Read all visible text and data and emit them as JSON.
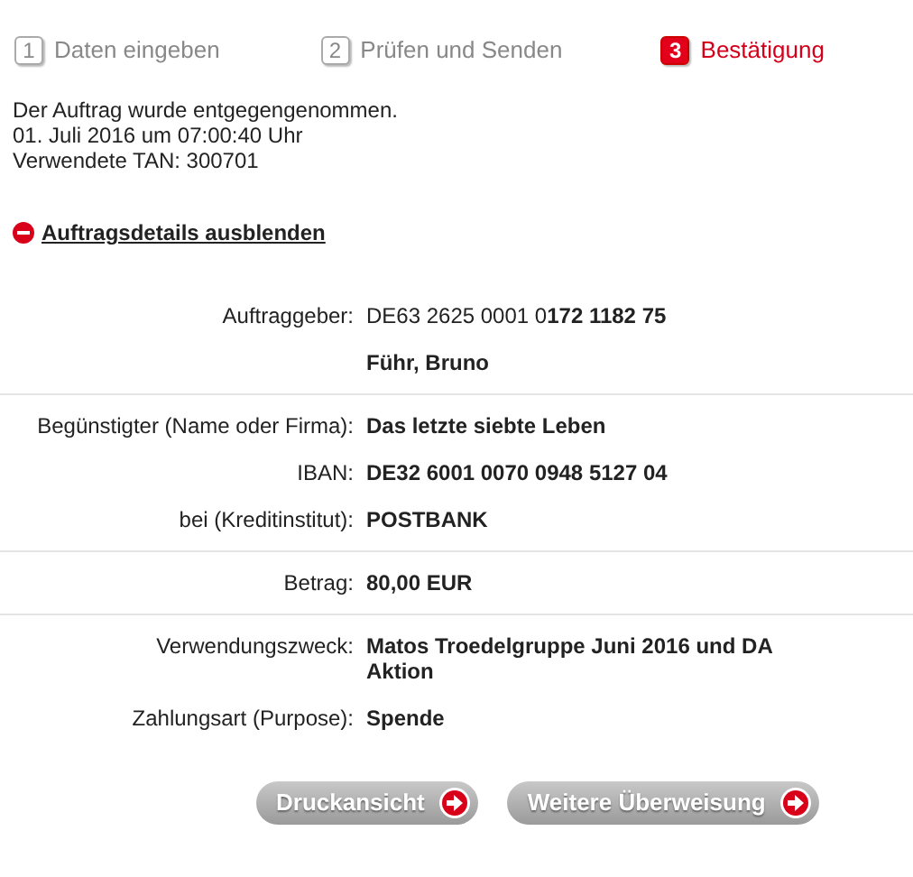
{
  "steps": [
    {
      "number": "1",
      "label": "Daten eingeben",
      "selected": false
    },
    {
      "number": "2",
      "label": "Prüfen und Senden",
      "selected": false
    },
    {
      "number": "3",
      "label": "Bestätigung",
      "selected": true
    }
  ],
  "confirmation": [
    "Der Auftrag wurde entgegengenommen.",
    "01. Juli 2016 um 07:00:40 Uhr",
    "Verwendete TAN: 300701"
  ],
  "toggle": {
    "label": "Auftragsdetails ausblenden",
    "expanded": true
  },
  "sections": [
    [
      {
        "kind": "account",
        "label": "Auftraggeber:",
        "value": "DE63 2625 0001 0**172 1182 75**"
      },
      {
        "kind": "detail",
        "value": "Führ, Bruno"
      }
    ],
    [
      {
        "kind": "detail",
        "label": "Begünstigter (Name oder Firma):",
        "value": "Das letzte siebte Leben"
      },
      {
        "kind": "detail",
        "label": "IBAN:",
        "value": "DE32 6001 0070 0948 5127 04"
      },
      {
        "kind": "detail",
        "label": "bei (Kreditinstitut):",
        "value": "POSTBANK"
      }
    ],
    [
      {
        "kind": "detail",
        "label": "Betrag:",
        "value": "80,00 EUR"
      }
    ],
    [
      {
        "kind": "detail",
        "label": "Verwendungszweck:",
        "value": "Matos Troedelgruppe Juni 2016 und DA Aktion"
      },
      {
        "kind": "detail",
        "label": "Zahlungsart (Purpose):",
        "value": "Spende"
      }
    ]
  ],
  "buttons": [
    "Druckansicht",
    "Weitere Überweisung"
  ]
}
